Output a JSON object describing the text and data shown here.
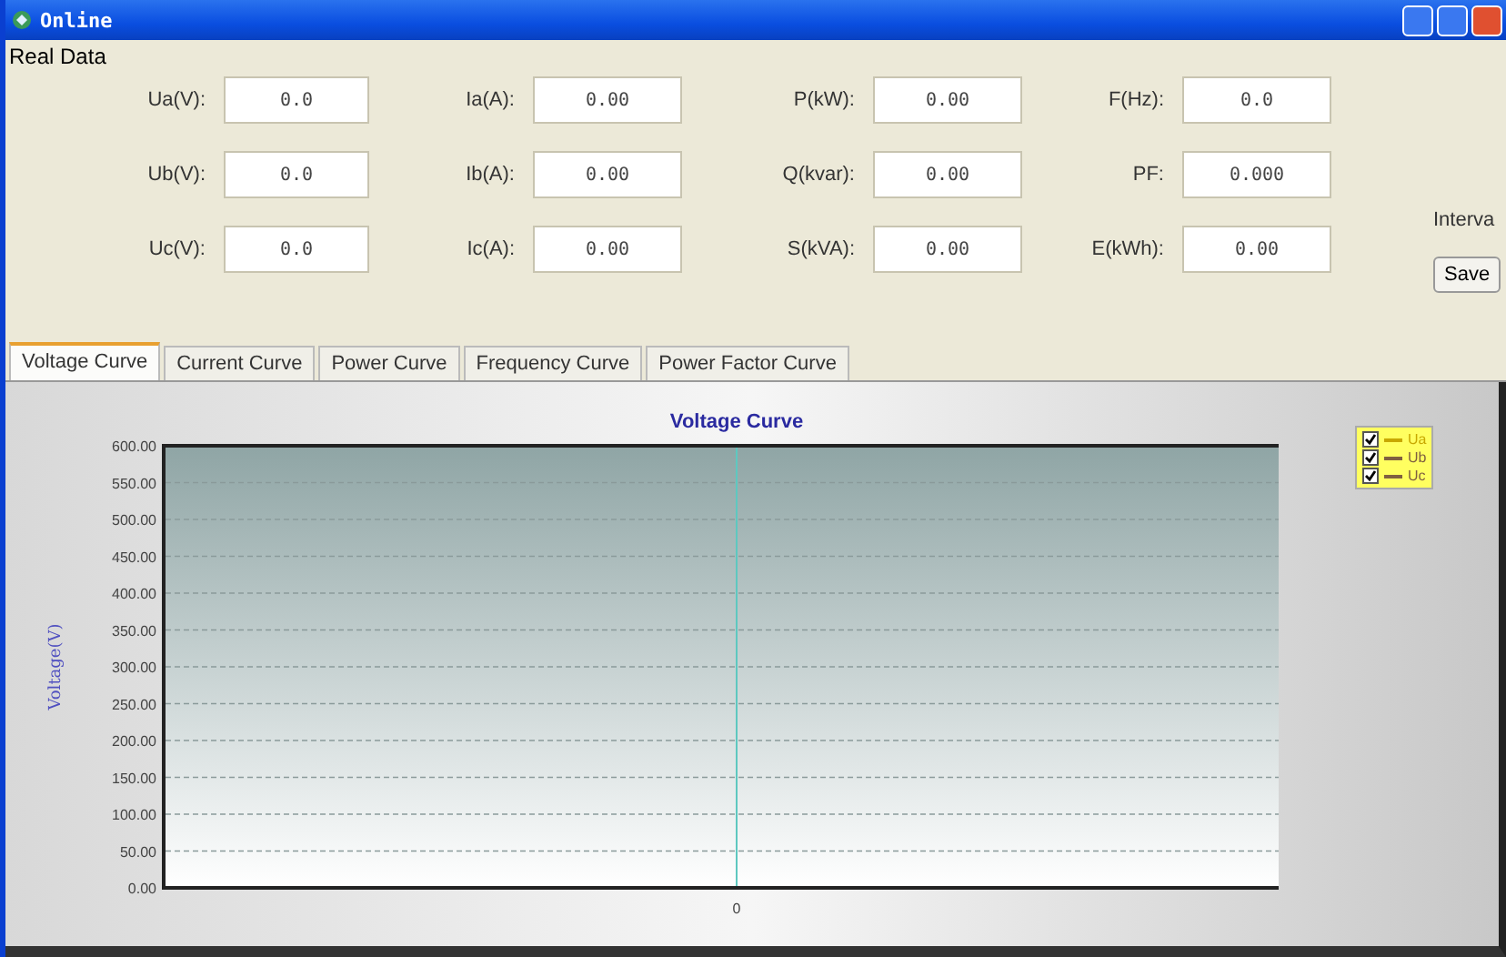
{
  "window": {
    "title": "Online"
  },
  "real_data": {
    "title": "Real Data",
    "rows": [
      [
        {
          "label": "Ua(V):",
          "value": "0.0"
        },
        {
          "label": "Ia(A):",
          "value": "0.00"
        },
        {
          "label": "P(kW):",
          "value": "0.00"
        },
        {
          "label": "F(Hz):",
          "value": "0.0"
        }
      ],
      [
        {
          "label": "Ub(V):",
          "value": "0.0"
        },
        {
          "label": "Ib(A):",
          "value": "0.00"
        },
        {
          "label": "Q(kvar):",
          "value": "0.00"
        },
        {
          "label": "PF:",
          "value": "0.000"
        }
      ],
      [
        {
          "label": "Uc(V):",
          "value": "0.0"
        },
        {
          "label": "Ic(A):",
          "value": "0.00"
        },
        {
          "label": "S(kVA):",
          "value": "0.00"
        },
        {
          "label": "E(kWh):",
          "value": "0.00"
        }
      ]
    ]
  },
  "side": {
    "interval_label": "Interva",
    "save_button": "Save"
  },
  "tabs": [
    {
      "label": "Voltage Curve",
      "selected": true
    },
    {
      "label": "Current Curve",
      "selected": false
    },
    {
      "label": "Power Curve",
      "selected": false
    },
    {
      "label": "Frequency Curve",
      "selected": false
    },
    {
      "label": "Power Factor Curve",
      "selected": false
    }
  ],
  "chart": {
    "title": "Voltage Curve",
    "ylabel": "Voltage(V)",
    "y_ticks": [
      "600.00",
      "550.00",
      "500.00",
      "450.00",
      "400.00",
      "350.00",
      "300.00",
      "250.00",
      "200.00",
      "150.00",
      "100.00",
      "50.00",
      "0.00"
    ],
    "x_ticks": [
      "0"
    ],
    "legend": [
      {
        "label": "Ua",
        "checked": true,
        "color": "#c8a800"
      },
      {
        "label": "Ub",
        "checked": true,
        "color": "#806040"
      },
      {
        "label": "Uc",
        "checked": true,
        "color": "#806040"
      }
    ]
  }
}
